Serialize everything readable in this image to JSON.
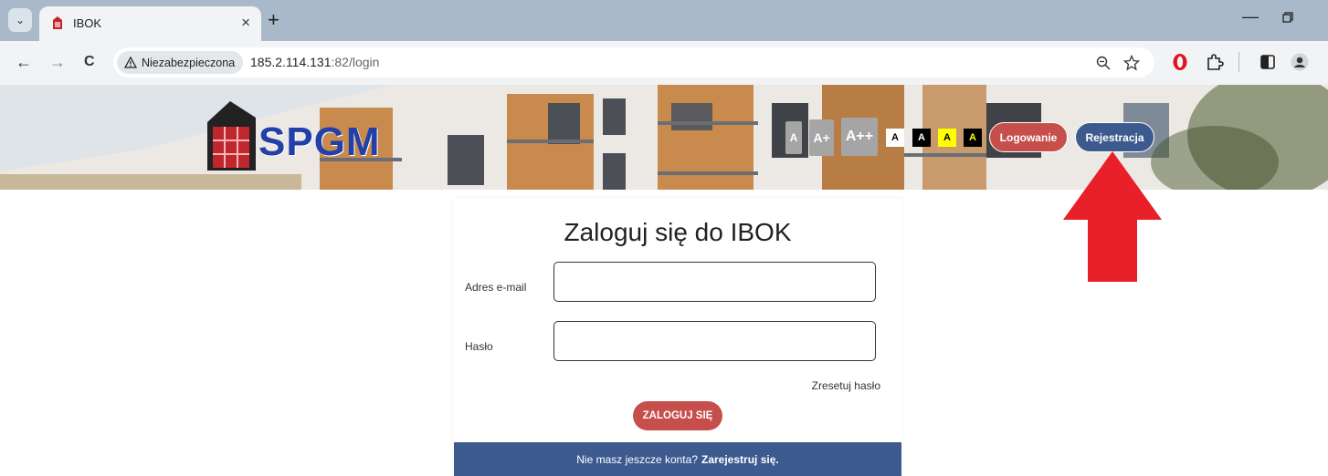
{
  "browser": {
    "tab_title": "IBOK",
    "tab_close": "×",
    "new_tab": "+",
    "minimize": "—",
    "back": "←",
    "forward": "→",
    "reload": "C",
    "security_label": "Niezabezpieczona",
    "url_host": "185.2.114.131",
    "url_port": ":82",
    "url_path": "/login"
  },
  "header": {
    "logo_text": "SPGM",
    "font_sizes": [
      "A",
      "A+",
      "A++"
    ],
    "contrast": [
      {
        "label": "A",
        "bg": "#ffffff",
        "fg": "#000000"
      },
      {
        "label": "A",
        "bg": "#000000",
        "fg": "#ffffff"
      },
      {
        "label": "A",
        "bg": "#ffff00",
        "fg": "#000000"
      },
      {
        "label": "A",
        "bg": "#000000",
        "fg": "#ffff00"
      }
    ],
    "login_label": "Logowanie",
    "register_label": "Rejestracja"
  },
  "login": {
    "title": "Zaloguj się do IBOK",
    "email_label": "Adres e-mail",
    "email_value": "",
    "password_label": "Hasło",
    "password_value": "",
    "reset_label": "Zresetuj hasło",
    "submit_label": "ZALOGUJ SIĘ",
    "footer_text": "Nie masz jeszcze konta?",
    "footer_link": "Zarejestruj się."
  },
  "colors": {
    "login_pill": "#c64e4b",
    "register_pill": "#3d5a8f",
    "footer_bar": "#3d5a8f",
    "arrow": "#e8202a"
  }
}
